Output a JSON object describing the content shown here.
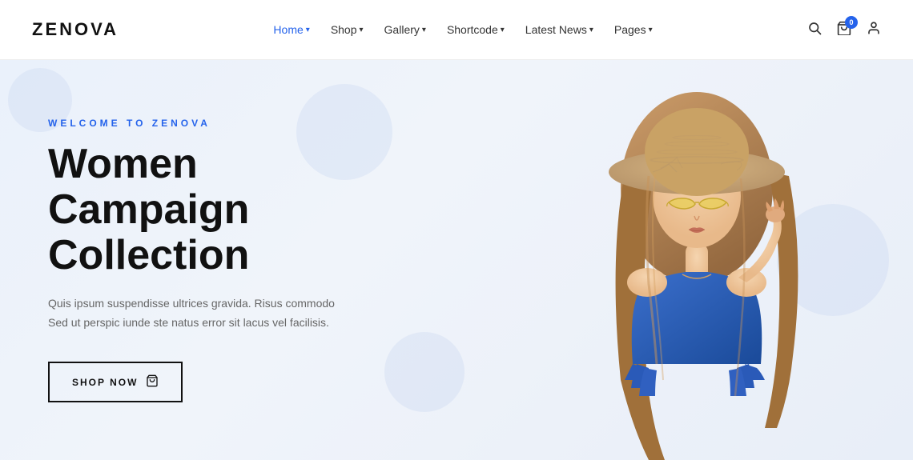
{
  "brand": {
    "name": "ZENOVA"
  },
  "nav": {
    "items": [
      {
        "label": "Home",
        "active": true,
        "has_dropdown": true
      },
      {
        "label": "Shop",
        "active": false,
        "has_dropdown": true
      },
      {
        "label": "Gallery",
        "active": false,
        "has_dropdown": true
      },
      {
        "label": "Shortcode",
        "active": false,
        "has_dropdown": true
      },
      {
        "label": "Latest News",
        "active": false,
        "has_dropdown": true
      },
      {
        "label": "Pages",
        "active": false,
        "has_dropdown": true
      }
    ]
  },
  "header_icons": {
    "search": "search",
    "cart": "cart",
    "cart_count": "0",
    "user": "user"
  },
  "hero": {
    "subtitle": "WELCOME TO ZENOVA",
    "title_line1": "Women Campaign",
    "title_line2": "Collection",
    "description": "Quis ipsum suspendisse ultrices gravida. Risus commodo Sed ut perspic iunde ste natus error sit lacus vel facilisis.",
    "cta_label": "SHOP NOW"
  }
}
